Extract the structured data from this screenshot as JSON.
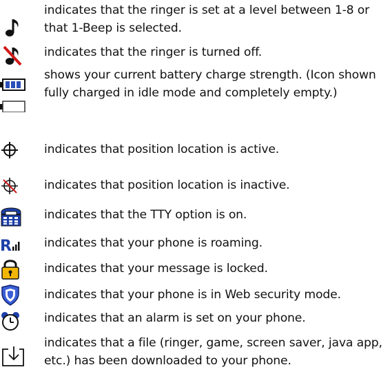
{
  "colors": {
    "icon_dark": "#111111",
    "icon_blue": "#1d3fa8",
    "ringer_off_slash": "#d11a1a",
    "location_inactive_slash": "#d11a1a",
    "lock_body": "#f2b705",
    "shield_fill": "#3a5fd6",
    "battery_fill": "#2a4fb8"
  },
  "items": [
    {
      "icon": "ringer-on-icon",
      "text": "indicates that the ringer is set at a level between 1-8 or that 1-Beep is selected."
    },
    {
      "icon": "ringer-off-icon",
      "text": "indicates that the ringer is turned off."
    },
    {
      "icon": "battery-icons",
      "text": "shows your current battery charge strength. (Icon shown fully charged in idle mode and completely empty.)"
    },
    {
      "icon": "location-active-icon",
      "text": "indicates that position location is active."
    },
    {
      "icon": "location-inactive-icon",
      "text": "indicates that position location is inactive."
    },
    {
      "icon": "tty-icon",
      "text": "indicates that the TTY option is on."
    },
    {
      "icon": "roaming-icon",
      "icon_text": "R",
      "text": "indicates that your phone is roaming."
    },
    {
      "icon": "lock-icon",
      "text": "indicates that your message is locked."
    },
    {
      "icon": "web-security-icon",
      "text": "indicates that your phone is in Web security  mode."
    },
    {
      "icon": "alarm-icon",
      "text": "indicates that an alarm is set on your phone."
    },
    {
      "icon": "download-icon",
      "text": "indicates that a file (ringer, game, screen saver, java app, etc.) has been downloaded to your phone."
    }
  ]
}
